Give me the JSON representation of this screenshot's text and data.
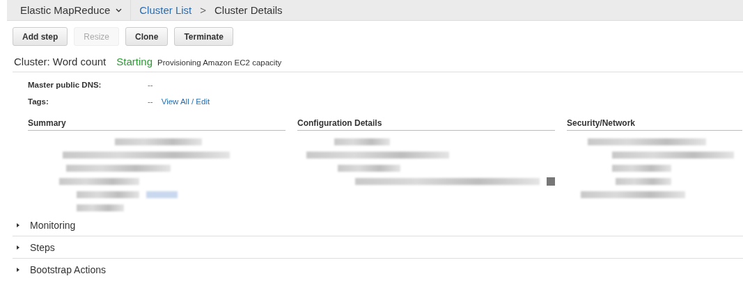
{
  "breadcrumb": {
    "service": "Elastic MapReduce",
    "link": "Cluster List",
    "separator": ">",
    "current": "Cluster Details"
  },
  "buttons": [
    {
      "label": "Add step",
      "disabled": false
    },
    {
      "label": "Resize",
      "disabled": true
    },
    {
      "label": "Clone",
      "disabled": false
    },
    {
      "label": "Terminate",
      "disabled": false
    }
  ],
  "cluster": {
    "title": "Cluster: Word count",
    "status": "Starting",
    "status_detail": "Provisioning Amazon EC2 capacity"
  },
  "details": [
    {
      "label": "Master public DNS:",
      "value": "--"
    },
    {
      "label": "Tags:",
      "value": "--",
      "link": "View All / Edit"
    }
  ],
  "columns": [
    {
      "heading": "Summary"
    },
    {
      "heading": "Configuration Details"
    },
    {
      "heading": "Security/Network"
    }
  ],
  "sections": [
    {
      "label": "Monitoring",
      "expanded": false
    },
    {
      "label": "Steps",
      "expanded": false
    },
    {
      "label": "Bootstrap Actions",
      "expanded": false
    }
  ]
}
